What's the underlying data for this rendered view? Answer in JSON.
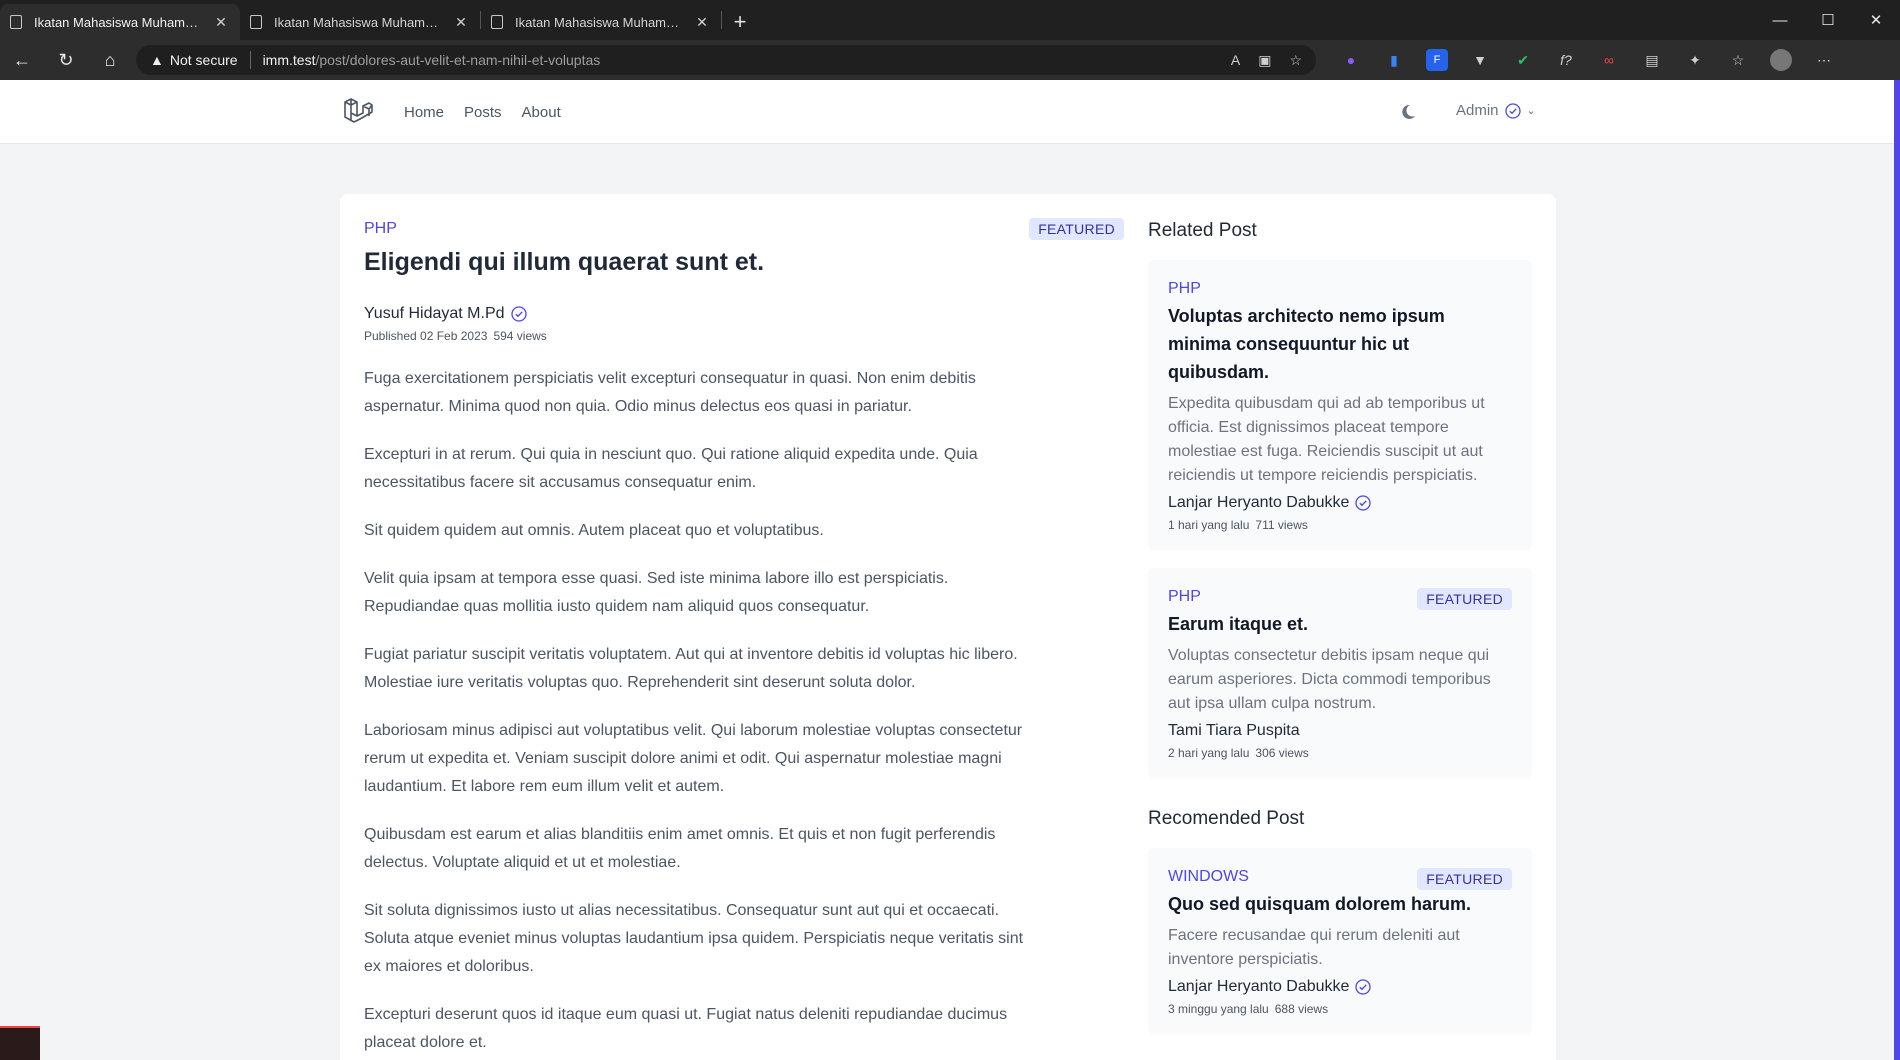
{
  "browser": {
    "tabs": [
      {
        "title": "Ikatan Mahasiswa Muhammadiyah"
      },
      {
        "title": "Ikatan Mahasiswa Muhammadiyah"
      },
      {
        "title": "Ikatan Mahasiswa Muhammadiyah"
      }
    ],
    "security_label": "Not secure",
    "url_host": "imm.test",
    "url_path": "/post/dolores-aut-velit-et-nam-nihil-et-voluptas"
  },
  "nav": {
    "items": [
      "Home",
      "Posts",
      "About"
    ],
    "user_label": "Admin"
  },
  "post": {
    "category": "PHP",
    "featured_label": "FEATURED",
    "title": "Eligendi qui illum quaerat sunt et.",
    "author": "Yusuf Hidayat M.Pd",
    "published": "Published 02 Feb 2023",
    "views": "594 views",
    "paragraphs": [
      "Fuga exercitationem perspiciatis velit excepturi consequatur in quasi. Non enim debitis aspernatur. Minima quod non quia. Odio minus delectus eos quasi in pariatur.",
      "Excepturi in at rerum. Qui quia in nesciunt quo. Qui ratione aliquid expedita unde. Quia necessitatibus facere sit accusamus consequatur enim.",
      "Sit quidem quidem aut omnis. Autem placeat quo et voluptatibus.",
      "Velit quia ipsam at tempora esse quasi. Sed iste minima labore illo est perspiciatis. Repudiandae quas mollitia iusto quidem nam aliquid quos consequatur.",
      "Fugiat pariatur suscipit veritatis voluptatem. Aut qui at inventore debitis id voluptas hic libero. Molestiae iure veritatis voluptas quo. Reprehenderit sint deserunt soluta dolor.",
      "Laboriosam minus adipisci aut voluptatibus velit. Qui laborum molestiae voluptas consectetur rerum ut expedita et. Veniam suscipit dolore animi et odit. Qui aspernatur molestiae magni laudantium. Et labore rem eum illum velit et autem.",
      "Quibusdam est earum et alias blanditiis enim amet omnis. Et quis et non fugit perferendis delectus. Voluptate aliquid et ut et molestiae.",
      "Sit soluta dignissimos iusto ut alias necessitatibus. Consequatur sunt aut qui et occaecati. Soluta atque eveniet minus voluptas laudantium ipsa quidem. Perspiciatis neque veritatis sint ex maiores et doloribus.",
      "Excepturi deserunt quos id itaque eum quasi ut. Fugiat natus deleniti repudiandae ducimus placeat dolore et."
    ]
  },
  "related": {
    "heading": "Related Post",
    "items": [
      {
        "category": "PHP",
        "title": "Voluptas architecto nemo ipsum minima consequuntur hic ut quibusdam.",
        "excerpt": "Expedita quibusdam qui ad ab temporibus ut officia. Est dignissimos placeat tempore molestiae est fuga. Reiciendis suscipit ut aut reiciendis ut tempore reiciendis perspiciatis.",
        "author": "Lanjar Heryanto Dabukke",
        "time": "1 hari yang lalu",
        "views": "711 views"
      },
      {
        "category": "PHP",
        "featured_label": "FEATURED",
        "title": "Earum itaque et.",
        "excerpt": "Voluptas consectetur debitis ipsam neque qui earum asperiores. Dicta commodi temporibus aut ipsa ullam culpa nostrum.",
        "author": "Tami Tiara Puspita",
        "time": "2 hari yang lalu",
        "views": "306 views"
      }
    ]
  },
  "recommended": {
    "heading": "Recomended Post",
    "items": [
      {
        "category": "WINDOWS",
        "featured_label": "FEATURED",
        "title": "Quo sed quisquam dolorem harum.",
        "excerpt": "Facere recusandae qui rerum deleniti aut inventore perspiciatis.",
        "author": "Lanjar Heryanto Dabukke",
        "time": "3 minggu yang lalu",
        "views": "688 views"
      }
    ]
  },
  "colors": {
    "accent": "#4f46e5",
    "badge_bg": "#e0e7ff",
    "badge_text": "#3730a3"
  }
}
